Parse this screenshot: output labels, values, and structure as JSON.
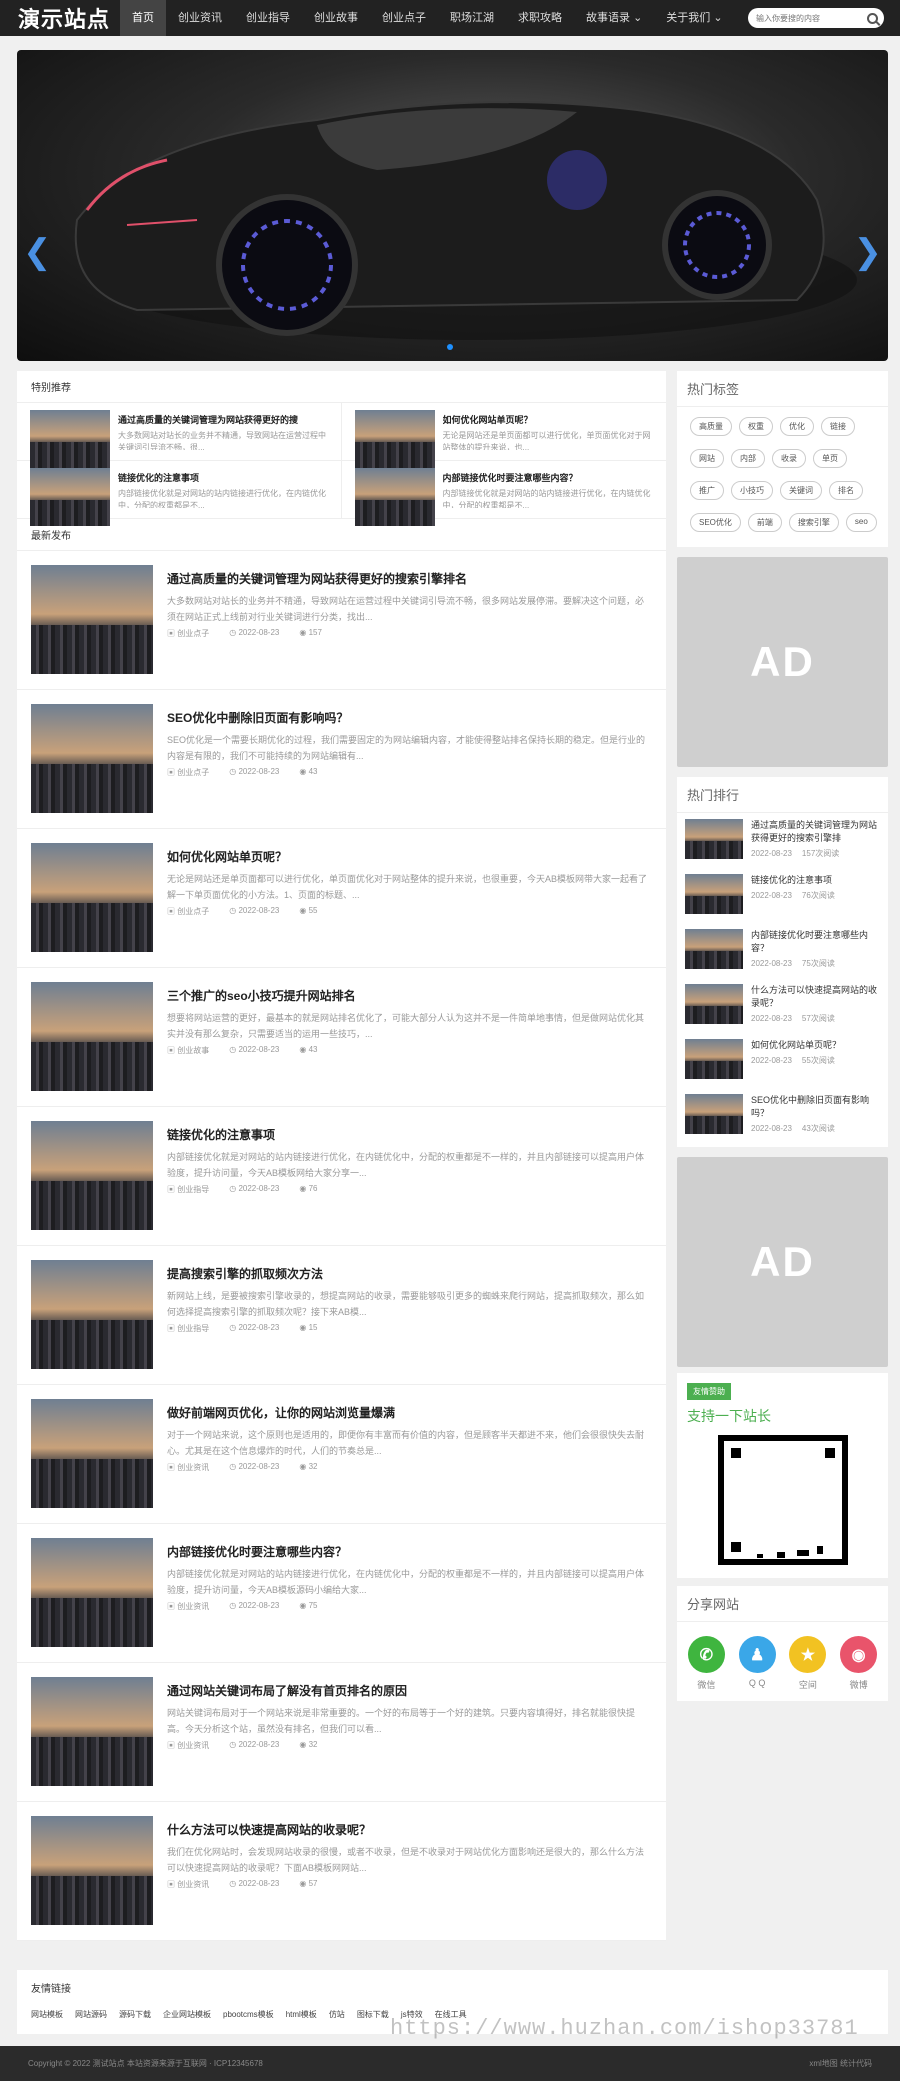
{
  "header": {
    "logo": "演示站点",
    "nav": [
      "首页",
      "创业资讯",
      "创业指导",
      "创业故事",
      "创业点子",
      "职场江湖",
      "求职攻略",
      "故事语录",
      "关于我们"
    ],
    "search_placeholder": "输入你要搜的内容"
  },
  "featured": {
    "title": "特别推荐",
    "items": [
      {
        "title": "通过高质量的关键词管理为网站获得更好的搜",
        "desc": "大多数网站对站长的业务并不精通，导致网站在运营过程中关键词引导流不畅，很..."
      },
      {
        "title": "如何优化网站单页呢？",
        "desc": "无论是网站还是单页面都可以进行优化，单页面优化对于网站整体的提升来说，也..."
      },
      {
        "title": "链接优化的注意事项",
        "desc": "内部链接优化就是对网站的站内链接进行优化，在内链优化中，分配的权重都是不..."
      },
      {
        "title": "内部链接优化时要注意哪些内容？",
        "desc": "内部链接优化就是对网站的站内链接进行优化，在内链优化中，分配的权重都是不..."
      }
    ]
  },
  "latest": {
    "title": "最新发布",
    "articles": [
      {
        "title": "通过高质量的关键词管理为网站获得更好的搜索引擎排名",
        "desc": "大多数网站对站长的业务并不精通，导致网站在运营过程中关键词引导流不畅，很多网站发展停滞。要解决这个问题，必须在网站正式上线前对行业关键词进行分类，找出...",
        "cat": "创业点子",
        "date": "2022-08-23",
        "views": "157"
      },
      {
        "title": "SEO优化中删除旧页面有影响吗？",
        "desc": "SEO优化是一个需要长期优化的过程，我们需要固定的为网站编辑内容，才能使得整站排名保持长期的稳定。但是行业的内容是有限的，我们不可能持续的为网站编辑有...",
        "cat": "创业点子",
        "date": "2022-08-23",
        "views": "43"
      },
      {
        "title": "如何优化网站单页呢？",
        "desc": "无论是网站还是单页面都可以进行优化，单页面优化对于网站整体的提升来说，也很重要，今天AB模板网带大家一起看了解一下单页面优化的小方法。1、页面的标题、...",
        "cat": "创业点子",
        "date": "2022-08-23",
        "views": "55"
      },
      {
        "title": "三个推广的seo小技巧提升网站排名",
        "desc": "想要将网站运营的更好，最基本的就是网站排名优化了，可能大部分人认为这并不是一件简单地事情，但是做网站优化其实并没有那么复杂，只需要适当的运用一些技巧，...",
        "cat": "创业故事",
        "date": "2022-08-23",
        "views": "43"
      },
      {
        "title": "链接优化的注意事项",
        "desc": "内部链接优化就是对网站的站内链接进行优化，在内链优化中，分配的权重都是不一样的，并且内部链接可以提高用户体验度，提升访问量，今天AB模板网给大家分享一...",
        "cat": "创业指导",
        "date": "2022-08-23",
        "views": "76"
      },
      {
        "title": "提高搜索引擎的抓取频次方法",
        "desc": "新网站上线，是要被搜索引擎收录的，想提高网站的收录，需要能够吸引更多的蜘蛛来爬行网站，提高抓取频次，那么如何选择提高搜索引擎的抓取频次呢？接下来AB模...",
        "cat": "创业指导",
        "date": "2022-08-23",
        "views": "15"
      },
      {
        "title": "做好前端网页优化，让你的网站浏览量爆满",
        "desc": "对于一个网站来说，这个原则也是适用的，即便你有丰富而有价值的内容，但是顾客半天都进不来，他们会很很快失去耐心。尤其是在这个信息爆炸的时代，人们的节奏总是...",
        "cat": "创业资讯",
        "date": "2022-08-23",
        "views": "32"
      },
      {
        "title": "内部链接优化时要注意哪些内容？",
        "desc": "内部链接优化就是对网站的站内链接进行优化，在内链优化中，分配的权重都是不一样的，并且内部链接可以提高用户体验度，提升访问量，今天AB模板源码小编给大家...",
        "cat": "创业资讯",
        "date": "2022-08-23",
        "views": "75"
      },
      {
        "title": "通过网站关键词布局了解没有首页排名的原因",
        "desc": "网站关键词布局对于一个网站来说是非常重要的。一个好的布局等于一个好的建筑。只要内容填得好，排名就能很快提高。今天分析这个站，虽然没有排名，但我们可以看...",
        "cat": "创业资讯",
        "date": "2022-08-23",
        "views": "32"
      },
      {
        "title": "什么方法可以快速提高网站的收录呢？",
        "desc": "我们在优化网站时，会发现网站收录的很慢，或者不收录，但是不收录对于网站优化方面影响还是很大的，那么什么方法可以快速提高网站的收录呢？下面AB模板网网站...",
        "cat": "创业资讯",
        "date": "2022-08-23",
        "views": "57"
      }
    ]
  },
  "sidebar": {
    "tags_title": "热门标签",
    "tags": [
      "高质量",
      "权重",
      "优化",
      "链接",
      "网站",
      "内部",
      "收录",
      "单页",
      "推广",
      "小技巧",
      "关键词",
      "排名",
      "SEO优化",
      "前端",
      "搜索引擎",
      "seo"
    ],
    "ad_text": "AD",
    "hot_title": "热门排行",
    "hot": [
      {
        "title": "通过高质量的关键词管理为网站获得更好的搜索引擎排",
        "date": "2022-08-23",
        "views": "157次阅读"
      },
      {
        "title": "链接优化的注意事项",
        "date": "2022-08-23",
        "views": "76次阅读"
      },
      {
        "title": "内部链接优化时要注意哪些内容？",
        "date": "2022-08-23",
        "views": "75次阅读"
      },
      {
        "title": "什么方法可以快速提高网站的收录呢？",
        "date": "2022-08-23",
        "views": "57次阅读"
      },
      {
        "title": "如何优化网站单页呢？",
        "date": "2022-08-23",
        "views": "55次阅读"
      },
      {
        "title": "SEO优化中删除旧页面有影响吗？",
        "date": "2022-08-23",
        "views": "43次阅读"
      }
    ],
    "friend_badge": "友情赞助",
    "friend_text": "支持一下站长",
    "share_title": "分享网站",
    "share": [
      {
        "label": "微信",
        "color": "#3fb53f",
        "glyph": "✆"
      },
      {
        "label": "Q Q",
        "color": "#3aa7e8",
        "glyph": "♟"
      },
      {
        "label": "空间",
        "color": "#f2c222",
        "glyph": "★"
      },
      {
        "label": "微博",
        "color": "#e9546b",
        "glyph": "◉"
      }
    ]
  },
  "links": {
    "title": "友情链接",
    "items": [
      "网站模板",
      "网站源码",
      "源码下载",
      "企业网站模板",
      "pbootcms模板",
      "html模板",
      "仿站",
      "图标下载",
      "js特效",
      "在线工具"
    ]
  },
  "footer": {
    "copyright": "Copyright © 2022 测试站点 本站资源来源于互联网 · ICP12345678",
    "right": "xml地图 统计代码"
  },
  "watermark": "https://www.huzhan.com/ishop33781"
}
